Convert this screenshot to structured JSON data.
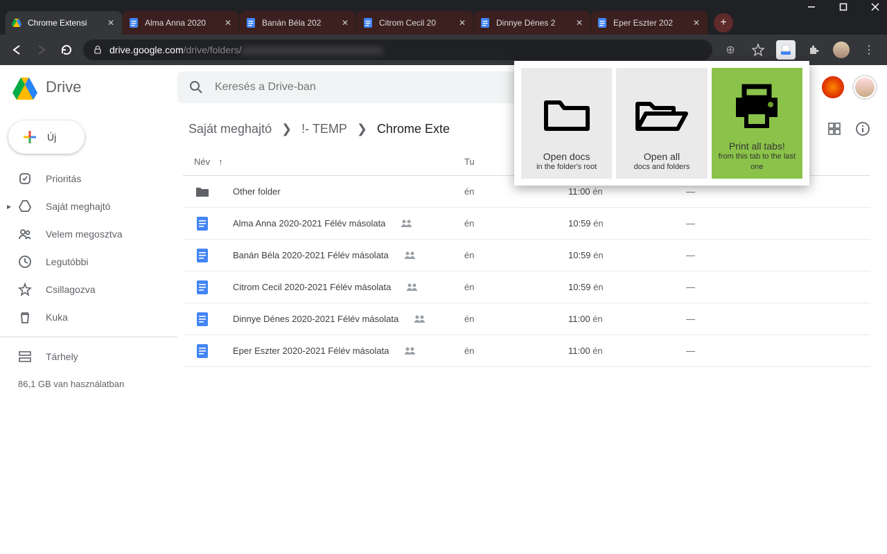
{
  "browser": {
    "tabs": [
      {
        "title": "Chrome Extensi"
      },
      {
        "title": "Alma Anna 2020"
      },
      {
        "title": "Banán Béla 202"
      },
      {
        "title": "Citrom Cecil 20"
      },
      {
        "title": "Dinnye Dénes 2"
      },
      {
        "title": "Eper Eszter 202"
      }
    ],
    "url_host": "drive.google.com",
    "url_path": "/drive/folders/",
    "url_rest": "xxxxxxxxxxxxxxxxxxxxxxxxxxxxx"
  },
  "drive": {
    "product": "Drive",
    "search_placeholder": "Keresés a Drive-ban",
    "new_button": "Új",
    "sidebar": [
      {
        "label": "Prioritás"
      },
      {
        "label": "Saját meghajtó"
      },
      {
        "label": "Velem megosztva"
      },
      {
        "label": "Legutóbbi"
      },
      {
        "label": "Csillagozva"
      },
      {
        "label": "Kuka"
      }
    ],
    "storage_label": "Tárhely",
    "storage_used": "86,1 GB van használatban",
    "breadcrumb": [
      "Saját meghajtó",
      "!- TEMP",
      "Chrome Exte"
    ],
    "columns": {
      "name": "Név",
      "owner": "Tu"
    },
    "files": [
      {
        "type": "folder",
        "name": "Other folder",
        "owner": "én",
        "mod_time": "11:00",
        "mod_by": "én",
        "size": "—",
        "shared": false
      },
      {
        "type": "doc",
        "name": "Alma Anna 2020-2021 Félév másolata",
        "owner": "én",
        "mod_time": "10:59",
        "mod_by": "én",
        "size": "—",
        "shared": true
      },
      {
        "type": "doc",
        "name": "Banán Béla 2020-2021 Félév másolata",
        "owner": "én",
        "mod_time": "10:59",
        "mod_by": "én",
        "size": "—",
        "shared": true
      },
      {
        "type": "doc",
        "name": "Citrom Cecil 2020-2021 Félév másolata",
        "owner": "én",
        "mod_time": "10:59",
        "mod_by": "én",
        "size": "—",
        "shared": true
      },
      {
        "type": "doc",
        "name": "Dinnye Dénes 2020-2021 Félév másolata",
        "owner": "én",
        "mod_time": "11:00",
        "mod_by": "én",
        "size": "—",
        "shared": true
      },
      {
        "type": "doc",
        "name": "Eper Eszter 2020-2021 Félév másolata",
        "owner": "én",
        "mod_time": "11:00",
        "mod_by": "én",
        "size": "—",
        "shared": true
      }
    ]
  },
  "ext": {
    "cards": [
      {
        "title": "Open docs",
        "sub": "in the folder's root"
      },
      {
        "title": "Open all",
        "sub": "docs and folders"
      },
      {
        "title": "Print all tabs!",
        "sub": "from this tab to the last one"
      }
    ]
  }
}
